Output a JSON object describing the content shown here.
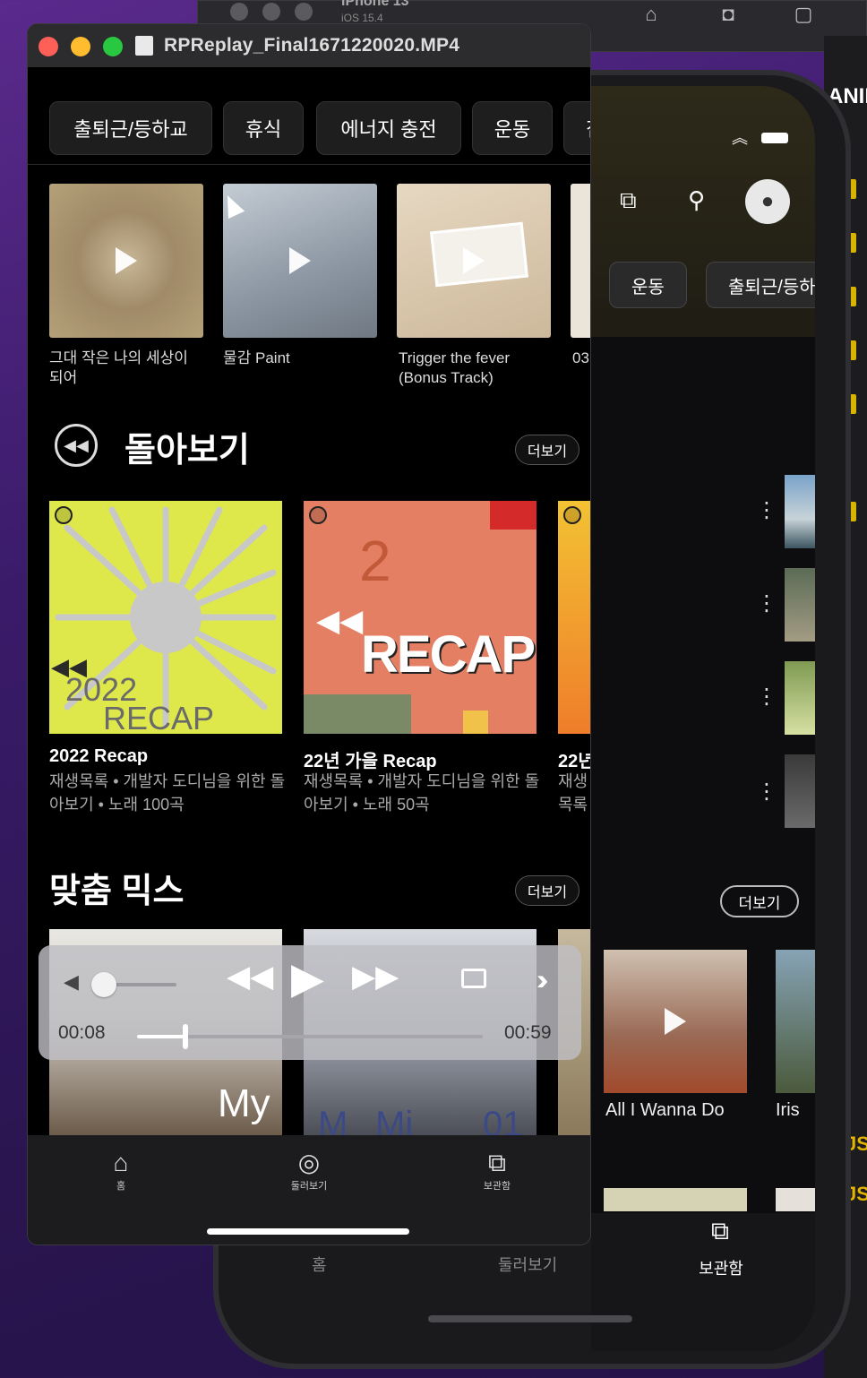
{
  "background_window": {
    "title": "iPhone 13",
    "subtitle": "iOS 15.4"
  },
  "phone": {
    "chips": [
      "운동",
      "출퇴근/등하"
    ],
    "more_label": "더보기",
    "cards": [
      "All I Wanna Do",
      "Iris"
    ],
    "tabs": [
      "홈",
      "둘러보기",
      "보관함"
    ],
    "side_code_labels": [
      "JS",
      "JS"
    ],
    "partial_heading": "ANIM"
  },
  "window": {
    "title": "RPReplay_Final1671220020.MP4",
    "chips": [
      "출퇴근/등하교",
      "휴식",
      "에너지 충전",
      "운동",
      "집"
    ],
    "albums": [
      {
        "label": "그대 작은 나의 세상이 되어",
        "color": "#a59072"
      },
      {
        "label": "물감 Paint",
        "color": "#9aa3ad"
      },
      {
        "label": "Trigger the fever (Bonus Track)",
        "color": "#d8c6ad"
      },
      {
        "label": "03",
        "color": "#e8e0d0"
      }
    ],
    "section_browse": {
      "title": "돌아보기",
      "more_label": "더보기",
      "cards": [
        {
          "title": "2022 Recap",
          "sub": "재생목록 • 개발자 도디님을 위한 돌아보기 • 노래 100곡",
          "art_text_1": "2022",
          "art_text_2": "RECAP",
          "color": "#dfe84a"
        },
        {
          "title": "22년 가을 Recap",
          "sub": "재생목록 • 개발자 도디님을 위한 돌아보기 • 노래 50곡",
          "art_text_1": "RECAP",
          "art_text_2": "2",
          "color": "#e57f63"
        },
        {
          "title": "22년",
          "sub": "재생목록 돌아",
          "color": "#f3c233"
        }
      ]
    },
    "section_mix": {
      "title": "맞춤 믹스",
      "more_label": "더보기",
      "art_text": [
        "My",
        "M",
        "Mi",
        "01"
      ]
    },
    "player": {
      "current_time": "00:08",
      "duration": "00:59",
      "progress": 0.14,
      "volume": 0.1
    },
    "nav": [
      {
        "label": "홈",
        "icon": "home-icon"
      },
      {
        "label": "둘러보기",
        "icon": "compass-icon"
      },
      {
        "label": "보관함",
        "icon": "library-icon"
      }
    ]
  }
}
